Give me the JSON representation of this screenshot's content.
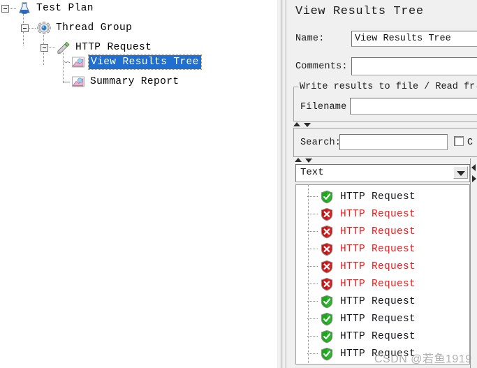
{
  "tree": {
    "nodes": [
      {
        "label": "Test Plan",
        "icon": "test-plan-icon",
        "depth": 0,
        "expanded": true,
        "selected": false
      },
      {
        "label": "Thread Group",
        "icon": "thread-group-icon",
        "depth": 1,
        "expanded": true,
        "selected": false
      },
      {
        "label": "HTTP Request",
        "icon": "http-request-icon",
        "depth": 2,
        "expanded": true,
        "selected": false
      },
      {
        "label": "View Results Tree",
        "icon": "view-results-tree-icon",
        "depth": 3,
        "expanded": false,
        "selected": true
      },
      {
        "label": "Summary Report",
        "icon": "summary-report-icon",
        "depth": 3,
        "expanded": false,
        "selected": false
      }
    ]
  },
  "panel": {
    "title": "View Results Tree",
    "name_label": "Name:",
    "name_value": "View Results Tree",
    "comments_label": "Comments:",
    "comments_value": "",
    "file_group_title": "Write results to file / Read fr",
    "filename_label": "Filename",
    "filename_value": "",
    "search_label": "Search:",
    "search_value": "",
    "search_placeholder": "",
    "case_checkbox_label": "C",
    "case_checkbox_checked": false,
    "renderer_selected": "Text"
  },
  "results": {
    "rows": [
      {
        "label": "HTTP Request",
        "status": "ok"
      },
      {
        "label": "HTTP Request",
        "status": "fail"
      },
      {
        "label": "HTTP Request",
        "status": "fail"
      },
      {
        "label": "HTTP Request",
        "status": "fail"
      },
      {
        "label": "HTTP Request",
        "status": "fail"
      },
      {
        "label": "HTTP Request",
        "status": "fail"
      },
      {
        "label": "HTTP Request",
        "status": "ok"
      },
      {
        "label": "HTTP Request",
        "status": "ok"
      },
      {
        "label": "HTTP Request",
        "status": "ok"
      },
      {
        "label": "HTTP Request",
        "status": "ok"
      }
    ]
  },
  "watermark": {
    "text": "CSDN @若鱼1919"
  },
  "colors": {
    "selection_bg": "#1f6fd0",
    "selection_border": "#e8820c",
    "fail_text": "#fc1515",
    "ok_text": "#14161c",
    "panel_bg": "#f0f0f0",
    "field_bg": "#ffffff"
  }
}
